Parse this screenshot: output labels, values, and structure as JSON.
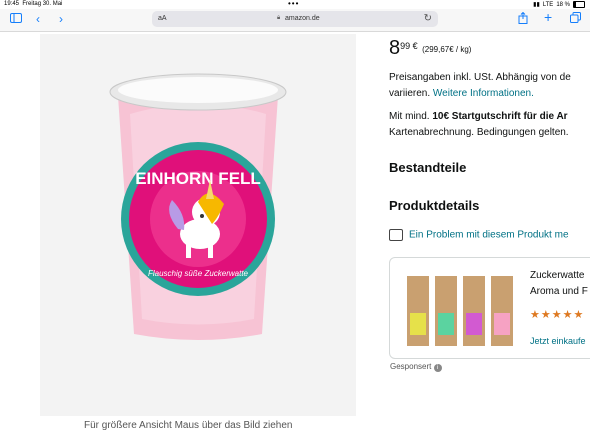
{
  "status": {
    "time": "19:45",
    "date": "Freitag 30. Mai",
    "network": "LTE",
    "battery": "18 %"
  },
  "browser": {
    "url_prefix": "aA",
    "domain": "amazon.de"
  },
  "product": {
    "price_main": "8",
    "price_cents": "99 €",
    "price_unit": "(299,67€ / kg)",
    "price_note_1": "Preisangaben inkl. USt. Abhängig von de",
    "price_note_2_prefix": "variieren.",
    "price_note_2_link": "Weitere Informationen.",
    "credit_prefix": "Mit mind.",
    "credit_bold": "10€ Startgutschrift für die Ar",
    "credit_line2": "Kartenabrechnung. Bedingungen gelten.",
    "image_caption": "Für größere Ansicht Maus über das Bild ziehen",
    "label_top": "EINHORN FELL",
    "label_bottom": "Flauschig süße Zuckerwatte"
  },
  "sections": {
    "ingredients": "Bestandteile",
    "details": "Produktdetails"
  },
  "report": "Ein Problem mit diesem Produkt me",
  "ad": {
    "title_1": "Zuckerwatte",
    "title_2": "Aroma und F",
    "stars": "★★★★★",
    "cta": "Jetzt einkaufe",
    "sponsored": "Gesponsert"
  },
  "colors": {
    "accent": "#147efb",
    "link": "#007185",
    "star": "#de7921",
    "label_pink": "#e0107a",
    "label_teal": "#2aa59a"
  }
}
